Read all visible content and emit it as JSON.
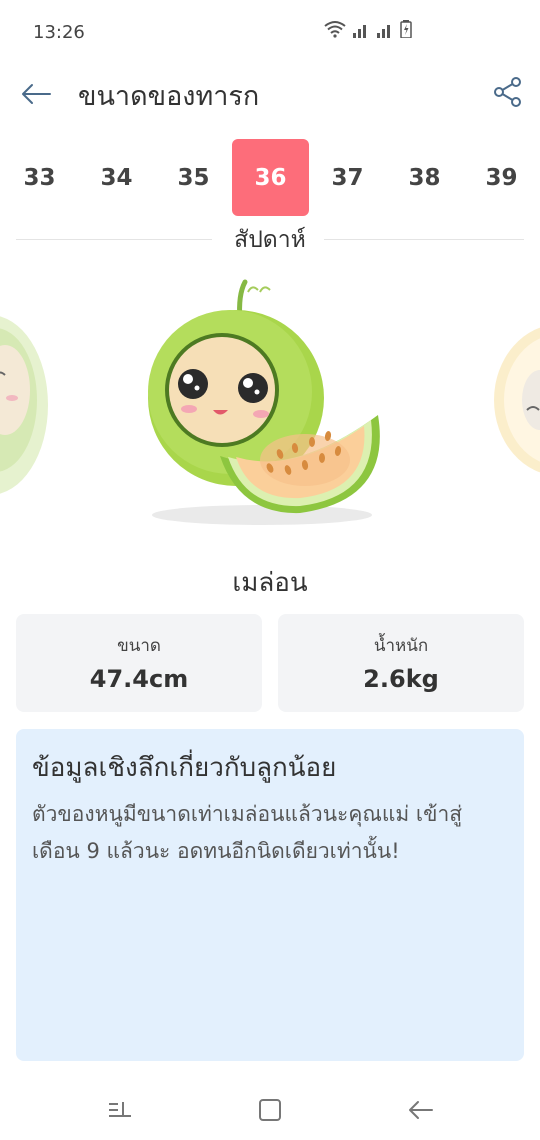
{
  "status": {
    "time": "13:26"
  },
  "app_bar": {
    "title": "ขนาดของทารก"
  },
  "weeks": {
    "items": [
      "33",
      "34",
      "35",
      "36",
      "37",
      "38",
      "39"
    ],
    "selected": "36",
    "label": "สัปดาห์"
  },
  "fruit": {
    "name": "เมล่อน"
  },
  "stats": {
    "size_label": "ขนาด",
    "size_value": "47.4cm",
    "weight_label": "น้ำหนัก",
    "weight_value": "2.6kg"
  },
  "info": {
    "title": "ข้อมูลเชิงลึกเกี่ยวกับลูกน้อย",
    "text": "ตัวของหนูมีขนาดเท่าเมล่อนแล้วนะคุณแม่ เข้าสู่เดือน 9 แล้วนะ อดทนอีกนิดเดียวเท่านั้น!"
  },
  "colors": {
    "accent": "#fd6d7a",
    "card_bg": "#f3f4f6",
    "info_bg": "#e3f0fd"
  }
}
